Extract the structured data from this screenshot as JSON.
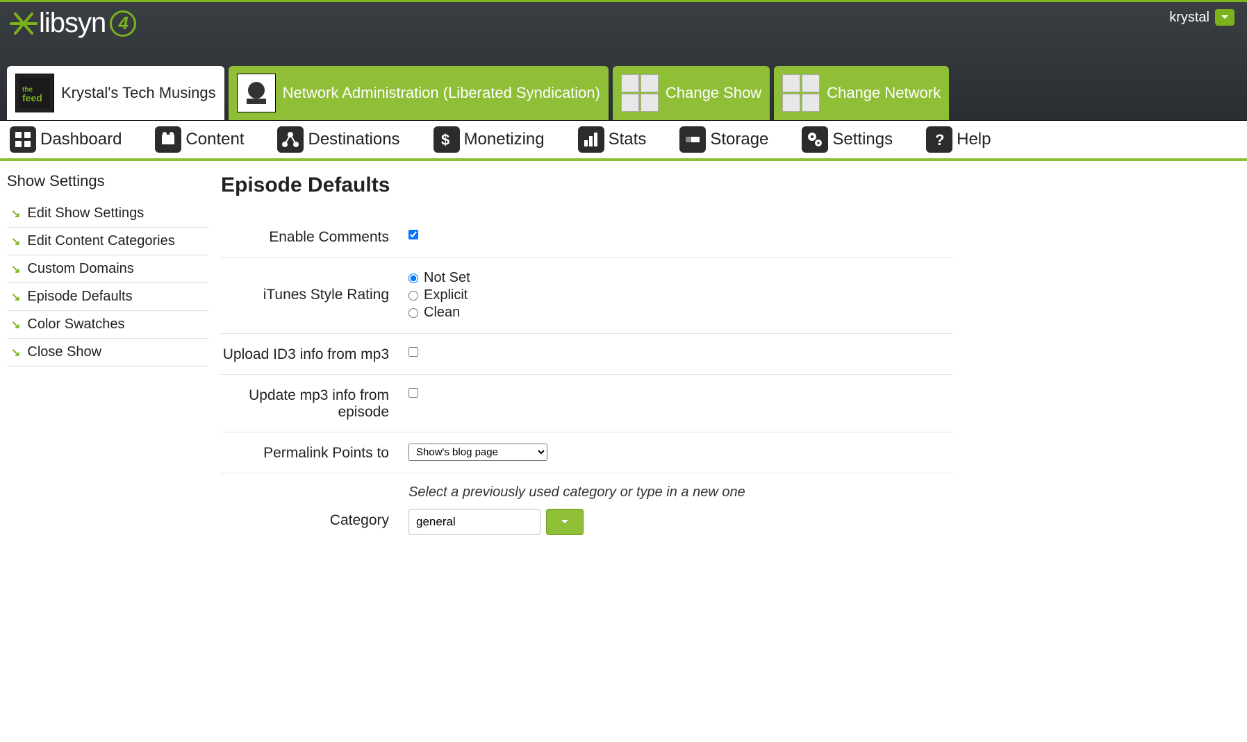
{
  "user": {
    "name": "krystal"
  },
  "brand": {
    "name": "libsyn",
    "version": "4"
  },
  "showtabs": [
    {
      "label": "Krystal's Tech Musings",
      "active": true
    },
    {
      "label": "Network Administration (Liberated Syndication)"
    },
    {
      "label": "Change Show"
    },
    {
      "label": "Change Network"
    }
  ],
  "mainnav": {
    "dashboard": "Dashboard",
    "content": "Content",
    "destinations": "Destinations",
    "monetizing": "Monetizing",
    "stats": "Stats",
    "storage": "Storage",
    "settings": "Settings",
    "help": "Help"
  },
  "sidebar": {
    "title": "Show Settings",
    "items": [
      "Edit Show Settings",
      "Edit Content Categories",
      "Custom Domains",
      "Episode Defaults",
      "Color Swatches",
      "Close Show"
    ]
  },
  "page": {
    "title": "Episode Defaults",
    "enable_comments": {
      "label": "Enable Comments",
      "checked": true
    },
    "itunes_rating": {
      "label": "iTunes Style Rating",
      "options": [
        "Not Set",
        "Explicit",
        "Clean"
      ],
      "selected": "Not Set"
    },
    "upload_id3": {
      "label": "Upload ID3 info from mp3",
      "checked": false
    },
    "update_mp3": {
      "label": "Update mp3 info from episode",
      "checked": false
    },
    "permalink": {
      "label": "Permalink Points to",
      "value": "Show's blog page"
    },
    "category": {
      "label": "Category",
      "hint": "Select a previously used category or type in a new one",
      "value": "general"
    }
  }
}
